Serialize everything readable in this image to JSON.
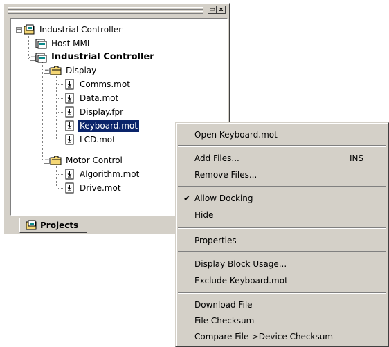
{
  "panel": {
    "tab_label": "Projects",
    "tree": [
      {
        "label": "Industrial Controller",
        "icon": "workspace-icon"
      },
      {
        "label": "Host MMI",
        "icon": "project-icon"
      },
      {
        "label": "Industrial Controller",
        "icon": "project-icon"
      },
      {
        "label": "Display",
        "icon": "folder-icon"
      },
      {
        "label": "Comms.mot",
        "icon": "file-icon"
      },
      {
        "label": "Data.mot",
        "icon": "file-icon"
      },
      {
        "label": "Display.fpr",
        "icon": "file-icon"
      },
      {
        "label": "Keyboard.mot",
        "icon": "file-icon"
      },
      {
        "label": "LCD.mot",
        "icon": "file-icon"
      },
      {
        "label": "Motor Control",
        "icon": "folder-icon"
      },
      {
        "label": "Algorithm.mot",
        "icon": "file-icon"
      },
      {
        "label": "Drive.mot",
        "icon": "file-icon"
      }
    ],
    "expand_glyph": "−",
    "close_glyph": "x",
    "restore_glyph": "▭"
  },
  "menu": {
    "items": [
      {
        "label": "Open Keyboard.mot"
      },
      {
        "label": "Add Files..."
      },
      {
        "label": "Remove Files..."
      },
      {
        "label": "Allow Docking"
      },
      {
        "label": "Hide"
      },
      {
        "label": "Properties"
      },
      {
        "label": "Display Block Usage..."
      },
      {
        "label": "Exclude Keyboard.mot"
      },
      {
        "label": "Download File"
      },
      {
        "label": "File Checksum"
      },
      {
        "label": "Compare File->Device Checksum"
      }
    ],
    "add_files_shortcut": "INS",
    "check_glyph": "✔"
  },
  "colors": {
    "face": "#d4d0c8",
    "selection": "#0a246a",
    "folder": "#f5d775"
  }
}
